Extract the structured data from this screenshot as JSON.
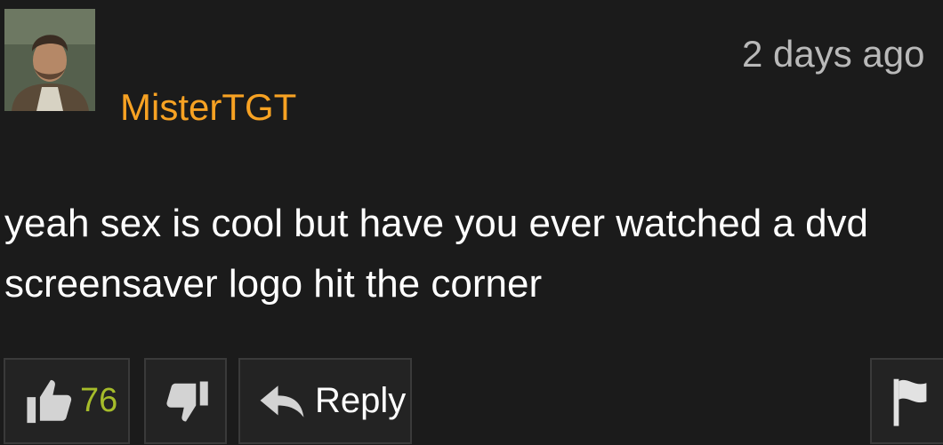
{
  "comment": {
    "username": "MisterTGT",
    "timestamp": "2 days ago",
    "text_lines": [
      "yeah sex is cool but have you ever watched a dvd",
      "screensaver logo hit the corner"
    ]
  },
  "actions": {
    "like_count": "76",
    "reply_label": "Reply"
  },
  "icons": {
    "like": "thumbs-up-icon",
    "dislike": "thumbs-down-icon",
    "reply": "reply-arrow-icon",
    "flag": "flag-icon"
  },
  "colors": {
    "background": "#1b1b1b",
    "username": "#f7a223",
    "like_count": "#a6bc2a",
    "timestamp": "#b9b9b9"
  }
}
